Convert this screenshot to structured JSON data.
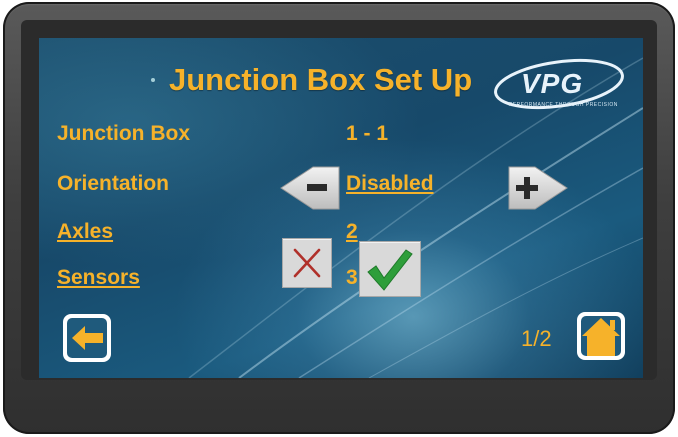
{
  "screen": {
    "title": "Junction Box Set Up",
    "page_indicator": "1/2"
  },
  "logo": {
    "text": "VPG",
    "tagline": "PERFORMANCE THROUGH PRECISION"
  },
  "fields": {
    "junction_box": {
      "label": "Junction Box",
      "value": "1 - 1"
    },
    "orientation": {
      "label": "Orientation",
      "value": "Disabled"
    },
    "axles": {
      "label": "Axles",
      "value": "2"
    },
    "sensors": {
      "label": "Sensors",
      "value": "3"
    }
  },
  "icons": {
    "decrement": "minus-arrow-icon",
    "increment": "plus-arrow-icon",
    "cancel": "red-x-icon",
    "confirm": "green-check-icon",
    "back": "left-arrow-icon",
    "home": "home-icon"
  },
  "colors": {
    "accent": "#f6b22a",
    "screen_bg": "#17496a",
    "confirm": "#2e9e3a",
    "cancel": "#b0302a"
  }
}
